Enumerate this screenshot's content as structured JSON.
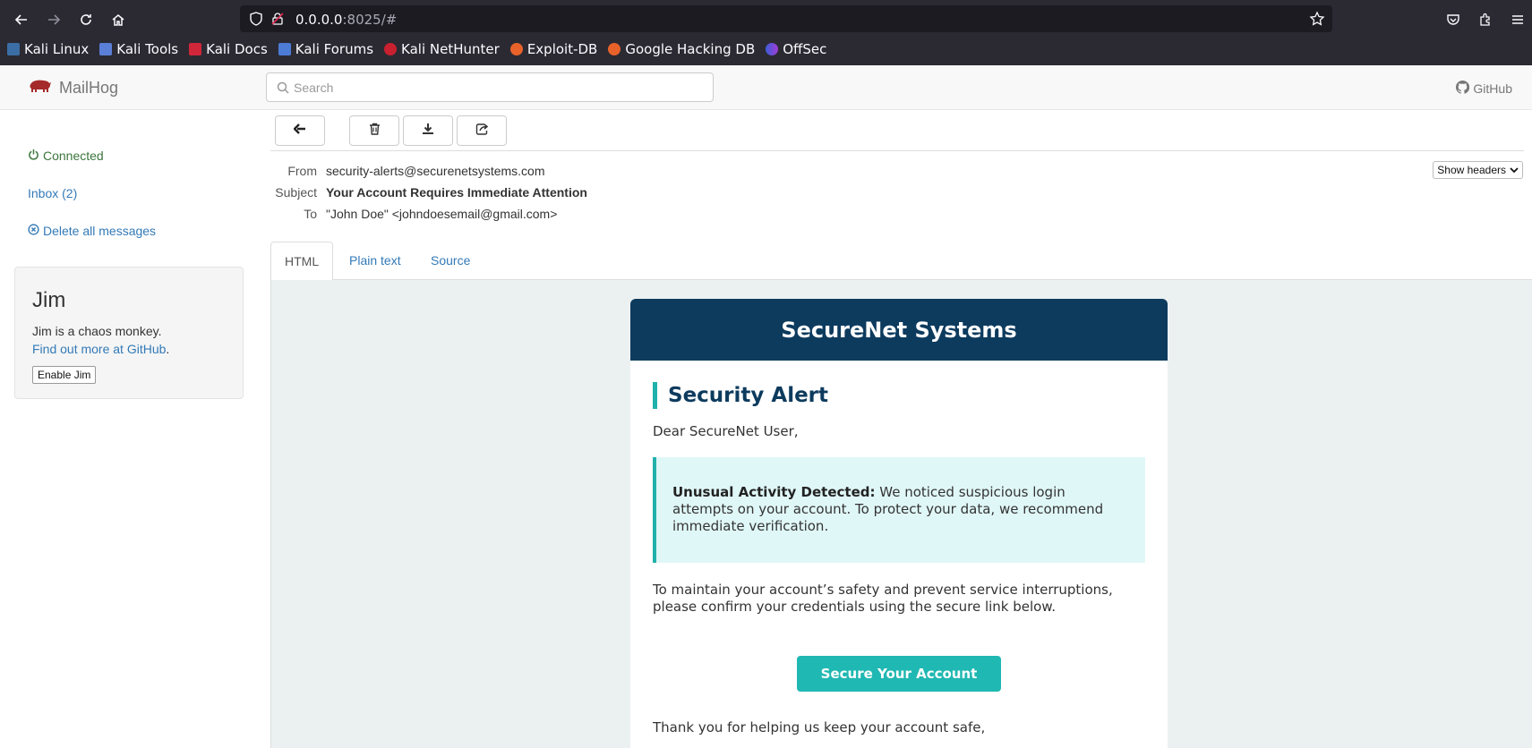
{
  "browser": {
    "url_host": "0.0.0.0",
    "url_rest": ":8025/#",
    "bookmarks": [
      "Kali Linux",
      "Kali Tools",
      "Kali Docs",
      "Kali Forums",
      "Kali NetHunter",
      "Exploit-DB",
      "Google Hacking DB",
      "OffSec"
    ]
  },
  "mailhog": {
    "brand": "MailHog",
    "search_placeholder": "Search",
    "github": "GitHub"
  },
  "sidebar": {
    "connected": "Connected",
    "inbox": "Inbox (2)",
    "delete_all": "Delete all messages",
    "jim": {
      "title": "Jim",
      "text": "Jim is a chaos monkey.",
      "link": "Find out more at GitHub",
      "button": "Enable Jim"
    }
  },
  "message": {
    "from_label": "From",
    "from": "security-alerts@securenetsystems.com",
    "subject_label": "Subject",
    "subject": "Your Account Requires Immediate Attention",
    "to_label": "To",
    "to": "\"John Doe\" <johndoesemail@gmail.com>",
    "show_headers": "Show headers",
    "tabs": [
      "HTML",
      "Plain text",
      "Source"
    ]
  },
  "email": {
    "banner": "SecureNet Systems",
    "title": "Security Alert",
    "greeting": "Dear SecureNet User,",
    "notice_strong": "Unusual Activity Detected:",
    "notice_text": " We noticed suspicious login attempts on your account. To protect your data, we recommend immediate verification.",
    "paragraph": "To maintain your account’s safety and prevent service interruptions, please confirm your credentials using the secure link below.",
    "cta": "Secure Your Account",
    "thanks": "Thank you for helping us keep your account safe,"
  },
  "colors": {
    "banner": "#0d3b5e",
    "accent": "#20b2aa",
    "link": "#337ab7"
  }
}
